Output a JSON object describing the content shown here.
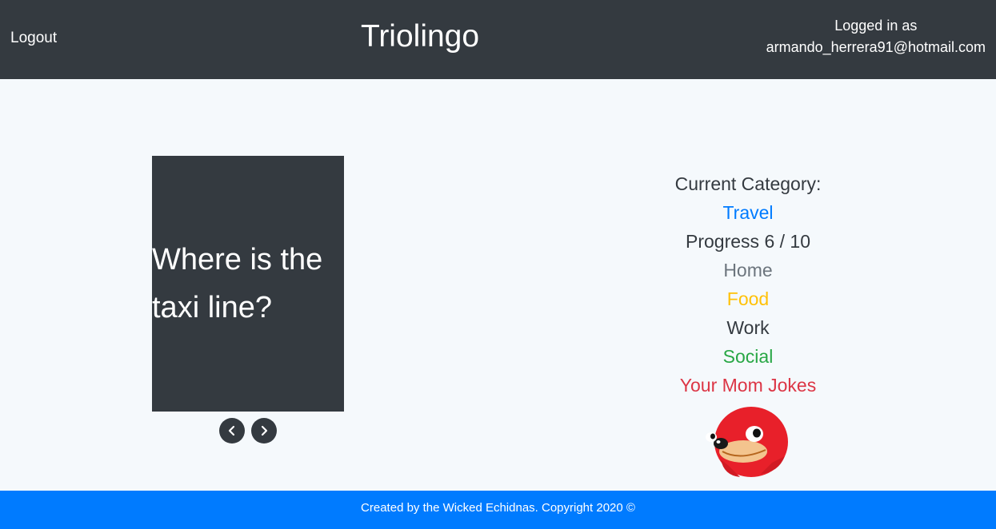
{
  "header": {
    "logout_label": "Logout",
    "brand": "Triolingo",
    "login_prefix": "Logged in as",
    "user_email": "armando_herrera91@hotmail.com"
  },
  "flashcard": {
    "text": "Where is the taxi line?"
  },
  "controls": {
    "prev_icon": "chevron-left-icon",
    "next_icon": "chevron-right-icon"
  },
  "sidebar": {
    "current_category_label": "Current Category:",
    "current_category": "Travel",
    "progress_text": "Progress 6 / 10",
    "progress": {
      "current": 6,
      "total": 10
    },
    "categories": [
      {
        "label": "Home",
        "color": "#6c757d"
      },
      {
        "label": "Food",
        "color": "#ffc107"
      },
      {
        "label": "Work",
        "color": "#343a40"
      },
      {
        "label": "Social",
        "color": "#28a745"
      },
      {
        "label": "Your Mom Jokes",
        "color": "#dc3545"
      }
    ],
    "current_color": "#007bff",
    "mascot_icon": "knuckles-mascot-icon"
  },
  "footer": {
    "text": "Created by the Wicked Echidnas. Copyright 2020 ©"
  },
  "colors": {
    "navbar": "#343a40",
    "footer": "#007bff",
    "background": "#f5f9fc"
  }
}
